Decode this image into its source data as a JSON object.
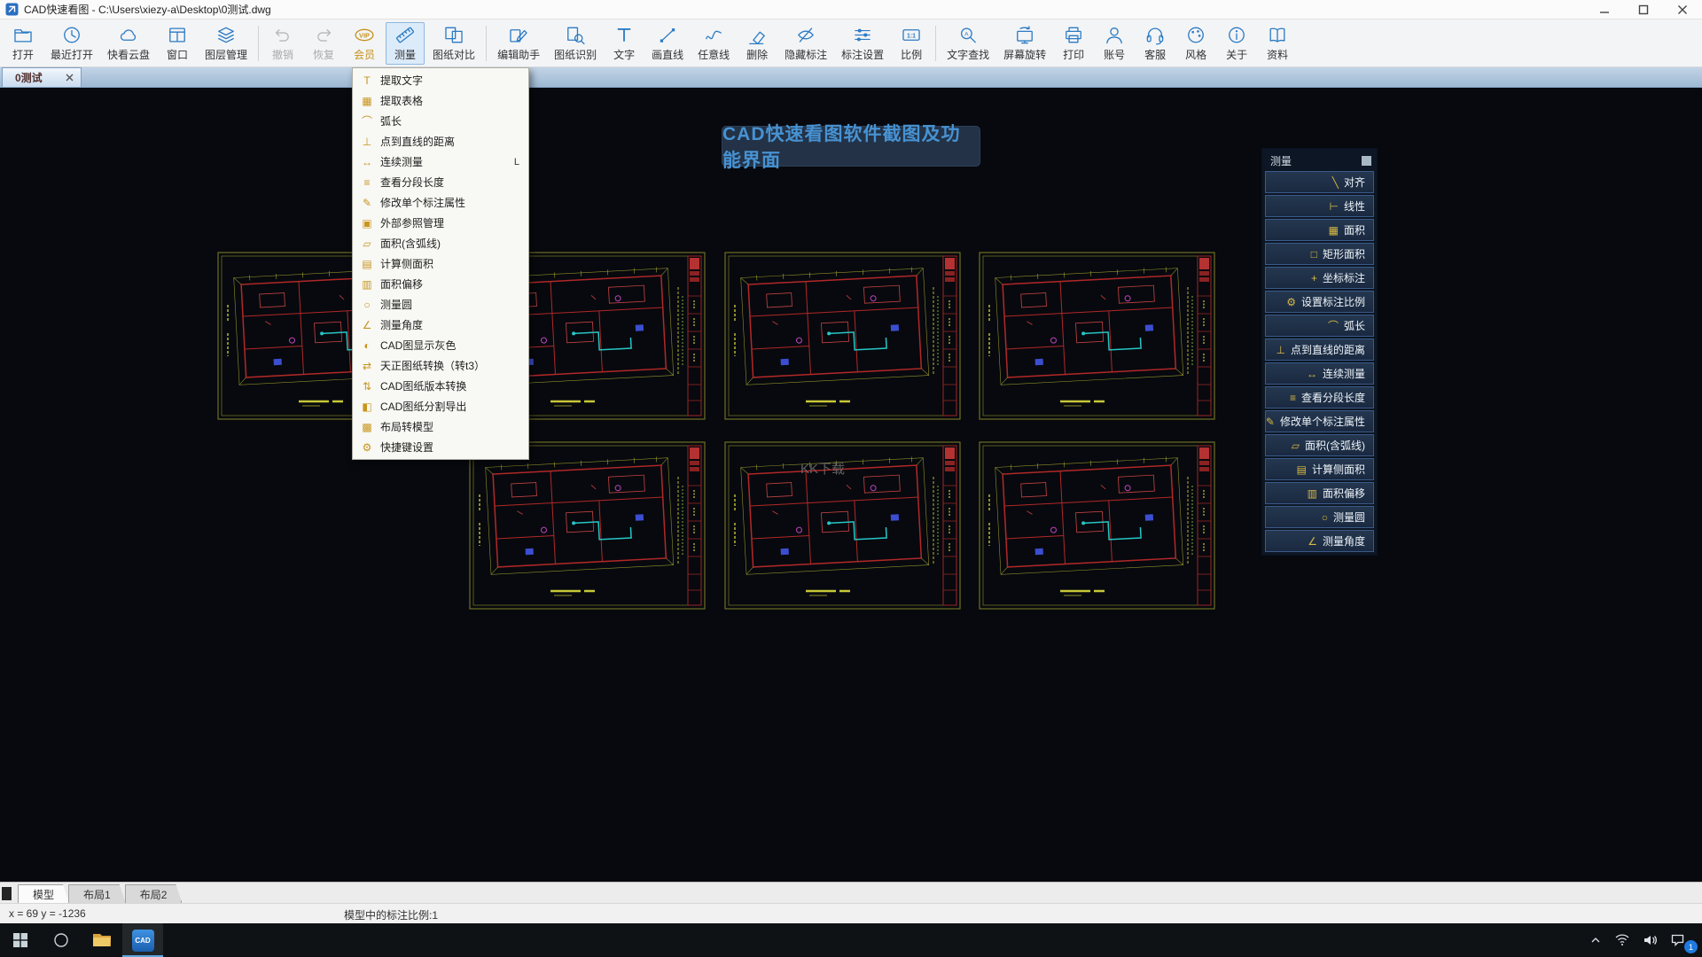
{
  "colors": {
    "accent_blue": "#2b7bc4",
    "vip_gold": "#c8921a",
    "active_button_bg": "#dcebfa",
    "canvas_bg": "#07090e",
    "badge_text_blue": "#4792d2",
    "panel_row_border": "#3a5a88"
  },
  "titlebar": {
    "title": "CAD快速看图 - C:\\Users\\xiezy-a\\Desktop\\0测试.dwg"
  },
  "toolbar": {
    "items": [
      {
        "label": "打开",
        "icon": "open"
      },
      {
        "label": "最近打开",
        "icon": "recent"
      },
      {
        "label": "快看云盘",
        "icon": "cloud"
      },
      {
        "label": "窗口",
        "icon": "window"
      },
      {
        "label": "图层管理",
        "icon": "layers",
        "sep_after": true
      },
      {
        "label": "撤销",
        "icon": "undo",
        "disabled": true
      },
      {
        "label": "恢复",
        "icon": "redo",
        "disabled": true
      },
      {
        "label": "会员",
        "icon": "vip",
        "vip": true
      },
      {
        "label": "测量",
        "icon": "measure",
        "active": true
      },
      {
        "label": "图纸对比",
        "icon": "compare",
        "sep_after": true
      },
      {
        "label": "编辑助手",
        "icon": "edit"
      },
      {
        "label": "图纸识别",
        "icon": "recognize"
      },
      {
        "label": "文字",
        "icon": "text"
      },
      {
        "label": "画直线",
        "icon": "line"
      },
      {
        "label": "任意线",
        "icon": "freeline"
      },
      {
        "label": "删除",
        "icon": "erase"
      },
      {
        "label": "隐藏标注",
        "icon": "hide"
      },
      {
        "label": "标注设置",
        "icon": "settings"
      },
      {
        "label": "比例",
        "icon": "scale",
        "sep_after": true
      },
      {
        "label": "文字查找",
        "icon": "search"
      },
      {
        "label": "屏幕旋转",
        "icon": "rotate"
      },
      {
        "label": "打印",
        "icon": "print"
      },
      {
        "label": "账号",
        "icon": "account"
      },
      {
        "label": "客服",
        "icon": "service"
      },
      {
        "label": "风格",
        "icon": "style"
      },
      {
        "label": "关于",
        "icon": "about"
      },
      {
        "label": "资料",
        "icon": "docs"
      }
    ]
  },
  "tabs": {
    "active_label": "0测试"
  },
  "menu": {
    "items": [
      {
        "glyph": "T",
        "label": "提取文字"
      },
      {
        "glyph": "▦",
        "label": "提取表格"
      },
      {
        "glyph": "⌒",
        "label": "弧长"
      },
      {
        "glyph": "⊥",
        "label": "点到直线的距离"
      },
      {
        "glyph": "↔",
        "label": "连续测量",
        "shortcut": "L"
      },
      {
        "glyph": "≡",
        "label": "查看分段长度"
      },
      {
        "glyph": "✎",
        "label": "修改单个标注属性"
      },
      {
        "glyph": "▣",
        "label": "外部参照管理"
      },
      {
        "glyph": "▱",
        "label": "面积(含弧线)"
      },
      {
        "glyph": "▤",
        "label": "计算侧面积"
      },
      {
        "glyph": "▥",
        "label": "面积偏移"
      },
      {
        "glyph": "○",
        "label": "测量圆"
      },
      {
        "glyph": "∠",
        "label": "测量角度"
      },
      {
        "glyph": "◐",
        "label": "CAD图显示灰色"
      },
      {
        "glyph": "⇄",
        "label": "天正图纸转换（转t3）"
      },
      {
        "glyph": "⇅",
        "label": "CAD图纸版本转换"
      },
      {
        "glyph": "◧",
        "label": "CAD图纸分割导出"
      },
      {
        "glyph": "▩",
        "label": "布局转模型"
      },
      {
        "glyph": "⚙",
        "label": "快捷键设置"
      }
    ]
  },
  "canvas": {
    "badge_text": "CAD快速看图软件截图及功能界面",
    "watermark": "KK下载"
  },
  "panel": {
    "title": "测量",
    "items": [
      {
        "glyph": "╲",
        "label": "对齐"
      },
      {
        "glyph": "⊢",
        "label": "线性"
      },
      {
        "glyph": "▦",
        "label": "面积"
      },
      {
        "glyph": "□",
        "label": "矩形面积"
      },
      {
        "glyph": "+",
        "label": "坐标标注"
      },
      {
        "glyph": "⚙",
        "label": "设置标注比例"
      },
      {
        "glyph": "⌒",
        "label": "弧长"
      },
      {
        "glyph": "⊥",
        "label": "点到直线的距离"
      },
      {
        "glyph": "↔",
        "label": "连续测量"
      },
      {
        "glyph": "≡",
        "label": "查看分段长度"
      },
      {
        "glyph": "✎",
        "label": "修改单个标注属性"
      },
      {
        "glyph": "▱",
        "label": "面积(含弧线)"
      },
      {
        "glyph": "▤",
        "label": "计算侧面积"
      },
      {
        "glyph": "▥",
        "label": "面积偏移"
      },
      {
        "glyph": "○",
        "label": "测量圆"
      },
      {
        "glyph": "∠",
        "label": "测量角度"
      }
    ]
  },
  "model_tabs": {
    "items": [
      {
        "label": "模型",
        "active": true
      },
      {
        "label": "布局1"
      },
      {
        "label": "布局2"
      }
    ]
  },
  "statusbar": {
    "coords": "x = 69  y = -1236",
    "scale_info": "模型中的标注比例:1"
  },
  "taskbar": {
    "cad_label": "CAD",
    "badge_count": "1"
  }
}
